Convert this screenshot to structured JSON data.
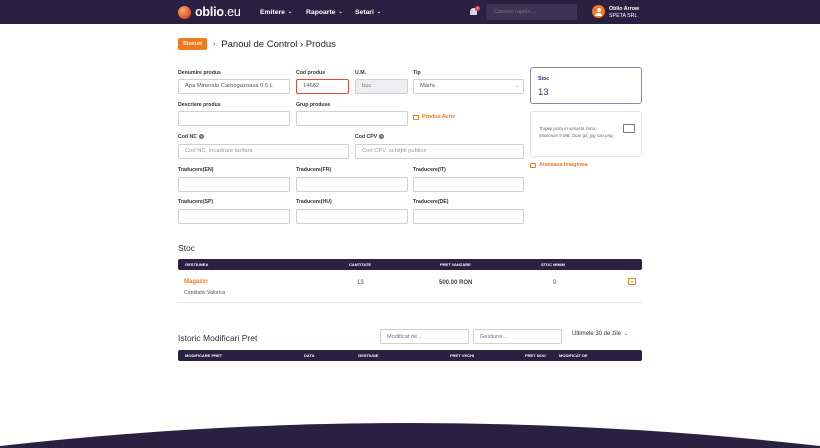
{
  "header": {
    "logo_text_main": "oblio",
    "logo_text_tld": ".eu",
    "nav": [
      {
        "label": "Emitere"
      },
      {
        "label": "Rapoarte"
      },
      {
        "label": "Setari"
      }
    ],
    "notification_count": "1",
    "search_placeholder": "Cautare rapida ...",
    "user_name": "Oblio Arrow",
    "user_company": "SPETA SRL"
  },
  "breadcrumb": {
    "badge": "Stocuri",
    "separator": "›",
    "title": "Panoul de Control › Produs"
  },
  "form": {
    "denumire_label": "Denumire produs",
    "denumire_value": "Apa Minerala Carbogazoasa 0.5 L",
    "cod_label": "Cod produs",
    "cod_value": "14682",
    "um_label": "U.M.",
    "um_value": "buc",
    "tip_label": "Tip",
    "tip_value": "Marfa",
    "descriere_label": "Descriere produs",
    "descriere_value": "",
    "grup_label": "Grup produse",
    "grup_value": "",
    "produs_activ_label": "Produs Activ",
    "cod_nc_label": "Cod NC",
    "cod_nc_placeholder": "Cod NC, incadrare tarifara",
    "cod_cpv_label": "Cod CPV",
    "cod_cpv_placeholder": "Cod CPV, schiţbil publice",
    "traduceri": [
      {
        "label": "Traducere(EN)"
      },
      {
        "label": "Traducere(FR)"
      },
      {
        "label": "Traducere(IT)"
      },
      {
        "label": "Traducere(SP)"
      },
      {
        "label": "Traducere(HU)"
      },
      {
        "label": "Traducere(DE)"
      }
    ]
  },
  "side": {
    "stoc_label": "Stoc",
    "stoc_value": "13",
    "drop_line1": "Trageţi poza in aceasta zona...",
    "drop_line2": "Maximum 5 MB. Doar gif, jpg sau png.",
    "attach_label": "Ataseaza imaginea"
  },
  "stoc_section": {
    "title": "Stoc",
    "columns": [
      "GESTIUNEA",
      "CANTITATE",
      "PRET VANZARE",
      "STOC MINIM"
    ],
    "rows": [
      {
        "gestiune": "Magazin",
        "sub": "Cantitativ Valorica",
        "cantitate": "13",
        "pret": "500.00 RON",
        "stoc_minim": "0"
      }
    ]
  },
  "istoric": {
    "title": "Istoric Modificari Pret",
    "filter_modificat_placeholder": "Modificat de...",
    "filter_gestiune_placeholder": "Gestiune...",
    "period_label": "Ultimele 30 de zile",
    "columns": [
      "MODIFICARE PRET",
      "DATA",
      "GESTIUNE",
      "PRET VECHI",
      "PRET NOU",
      "MODIFICAT DE"
    ]
  },
  "colors": {
    "topbar": "#2a2142",
    "accent": "#f07a1f",
    "error_border": "#e24a3b"
  }
}
